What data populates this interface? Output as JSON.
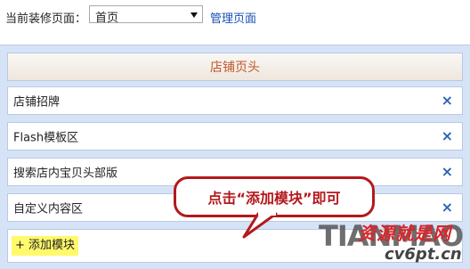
{
  "toolbar": {
    "current_page_label": "当前装修页面：",
    "page_select_value": "首页",
    "manage_link": "管理页面"
  },
  "panel": {
    "header_title": "店铺页头",
    "rows": [
      {
        "label": "店铺招牌"
      },
      {
        "label": "Flash模板区"
      },
      {
        "label": "搜索店内宝贝头部版"
      },
      {
        "label": "自定义内容区"
      }
    ],
    "add_module_label": "+ 添加模块",
    "close_glyph": "×"
  },
  "callout": {
    "text": "点击“添加模块”即可"
  },
  "watermark": {
    "brand": "TIANMAO",
    "cn": "资源就是网",
    "site": "cv6pt.cn"
  },
  "colors": {
    "accent_link": "#1a4fb5",
    "header_text": "#c0582a",
    "callout_red": "#b3191c",
    "highlight": "#fff96b",
    "panel_bg": "#d6e3f7"
  }
}
